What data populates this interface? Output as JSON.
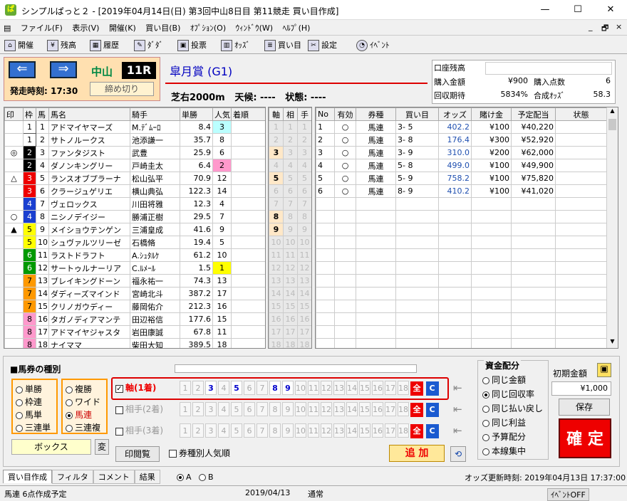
{
  "window": {
    "title": "シンプルぱっと２ - [2019年04月14日(日)  第3回中山8日目  第11競走 買い目作成]",
    "min": "—",
    "max": "☐",
    "close": "✕"
  },
  "menu": [
    "ファイル(F)",
    "表示(V)",
    "開催(K)",
    "買い目(B)",
    "ｵﾌﾟｼｮﾝ(O)",
    "ｳｨﾝﾄﾞｳ(W)",
    "ﾍﾙﾌﾟ(H)"
  ],
  "mdi": {
    "min": "_",
    "restore": "🗗",
    "close": "×"
  },
  "toolbar": [
    "開催",
    "残高",
    "履歴",
    "ﾀﾞﾀﾞ",
    "投票",
    "ｵｯｽﾞ",
    "買い目",
    "設定",
    "ｲﾍﾞﾝﾄ"
  ],
  "race": {
    "venue": "中山",
    "number": "11R",
    "post_time": "発走時刻: 17:30",
    "close_label": "締め切り",
    "name": "皐月賞 (G1)",
    "course": "芝右2000m",
    "weather": "天候: ----",
    "condition": "状態: ----"
  },
  "summary": {
    "account_label": "口座残高",
    "account_value": "",
    "buy_amount_label": "購入金額",
    "buy_amount": "¥900",
    "buy_count_label": "購入点数",
    "buy_count": "6",
    "expected_label": "回収期待",
    "expected": "5834%",
    "odds_label": "合成ｵｯｽﾞ",
    "odds": "58.3"
  },
  "horses_header": [
    "印",
    "枠",
    "馬",
    "馬名",
    "騎手",
    "単勝",
    "人気",
    "着順"
  ],
  "horses": [
    {
      "mark": "",
      "waku": "1",
      "num": "1",
      "name": "アドマイヤマーズ",
      "jockey": "M.ﾃﾞﾑｰﾛ",
      "odds": "8.4",
      "pop": "3",
      "color": "w1",
      "pc": "pop3"
    },
    {
      "mark": "",
      "waku": "1",
      "num": "2",
      "name": "サトノルークス",
      "jockey": "池添謙一",
      "odds": "35.7",
      "pop": "8",
      "color": "w1",
      "pc": ""
    },
    {
      "mark": "◎",
      "waku": "2",
      "num": "3",
      "name": "ファンタジスト",
      "jockey": "武豊",
      "odds": "25.9",
      "pop": "6",
      "color": "w2",
      "pc": ""
    },
    {
      "mark": "",
      "waku": "2",
      "num": "4",
      "name": "ダノンキングリー",
      "jockey": "戸崎圭太",
      "odds": "6.4",
      "pop": "2",
      "color": "w2",
      "pc": "pop2"
    },
    {
      "mark": "△",
      "waku": "3",
      "num": "5",
      "name": "ランスオブプラーナ",
      "jockey": "松山弘平",
      "odds": "70.9",
      "pop": "12",
      "color": "w3",
      "pc": ""
    },
    {
      "mark": "",
      "waku": "3",
      "num": "6",
      "name": "クラージュゲリエ",
      "jockey": "横山典弘",
      "odds": "122.3",
      "pop": "14",
      "color": "w3",
      "pc": ""
    },
    {
      "mark": "",
      "waku": "4",
      "num": "7",
      "name": "ヴェロックス",
      "jockey": "川田将雅",
      "odds": "12.3",
      "pop": "4",
      "color": "w4",
      "pc": ""
    },
    {
      "mark": "○",
      "waku": "4",
      "num": "8",
      "name": "ニシノデイジー",
      "jockey": "勝浦正樹",
      "odds": "29.5",
      "pop": "7",
      "color": "w4",
      "pc": ""
    },
    {
      "mark": "▲",
      "waku": "5",
      "num": "9",
      "name": "メイショウテンゲン",
      "jockey": "三浦皇成",
      "odds": "41.6",
      "pop": "9",
      "color": "w5",
      "pc": ""
    },
    {
      "mark": "",
      "waku": "5",
      "num": "10",
      "name": "シュヴァルツリーゼ",
      "jockey": "石橋脩",
      "odds": "19.4",
      "pop": "5",
      "color": "w5",
      "pc": ""
    },
    {
      "mark": "",
      "waku": "6",
      "num": "11",
      "name": "ラストドラフト",
      "jockey": "A.ｼｭﾀﾙｹ",
      "odds": "61.2",
      "pop": "10",
      "color": "w6",
      "pc": ""
    },
    {
      "mark": "",
      "waku": "6",
      "num": "12",
      "name": "サートゥルナーリア",
      "jockey": "C.ﾙﾒｰﾙ",
      "odds": "1.5",
      "pop": "1",
      "color": "w6",
      "pc": "pop1"
    },
    {
      "mark": "",
      "waku": "7",
      "num": "13",
      "name": "ブレイキングドーン",
      "jockey": "福永祐一",
      "odds": "74.3",
      "pop": "13",
      "color": "w7",
      "pc": ""
    },
    {
      "mark": "",
      "waku": "7",
      "num": "14",
      "name": "ダディーズマインド",
      "jockey": "宮崎北斗",
      "odds": "387.2",
      "pop": "17",
      "color": "w7",
      "pc": ""
    },
    {
      "mark": "",
      "waku": "7",
      "num": "15",
      "name": "クリノガウディー",
      "jockey": "藤岡佑介",
      "odds": "212.3",
      "pop": "16",
      "color": "w7",
      "pc": ""
    },
    {
      "mark": "",
      "waku": "8",
      "num": "16",
      "name": "タガノディアマンテ",
      "jockey": "田辺裕信",
      "odds": "177.6",
      "pop": "15",
      "color": "w8",
      "pc": ""
    },
    {
      "mark": "",
      "waku": "8",
      "num": "17",
      "name": "アドマイヤジャスタ",
      "jockey": "岩田康誠",
      "odds": "67.8",
      "pop": "11",
      "color": "w8",
      "pc": ""
    },
    {
      "mark": "",
      "waku": "8",
      "num": "18",
      "name": "ナイママ",
      "jockey": "柴田大知",
      "odds": "389.5",
      "pop": "18",
      "color": "w8",
      "pc": ""
    }
  ],
  "axis_header": [
    "軸",
    "相",
    "手"
  ],
  "axis_hits": [
    3,
    5,
    8,
    9
  ],
  "bets_header": [
    "No",
    "有効",
    "券種",
    "買い目",
    "オッズ",
    "賭け金",
    "予定配当",
    "状態"
  ],
  "bets": [
    {
      "no": "1",
      "valid": "○",
      "kind": "馬連",
      "combo": "3- 5",
      "odds": "402.2",
      "stake": "¥100",
      "payout": "¥40,220",
      "state": ""
    },
    {
      "no": "2",
      "valid": "○",
      "kind": "馬連",
      "combo": "3- 8",
      "odds": "176.4",
      "stake": "¥300",
      "payout": "¥52,920",
      "state": ""
    },
    {
      "no": "3",
      "valid": "○",
      "kind": "馬連",
      "combo": "3- 9",
      "odds": "310.0",
      "stake": "¥200",
      "payout": "¥62,000",
      "state": ""
    },
    {
      "no": "4",
      "valid": "○",
      "kind": "馬連",
      "combo": "5- 8",
      "odds": "499.0",
      "stake": "¥100",
      "payout": "¥49,900",
      "state": ""
    },
    {
      "no": "5",
      "valid": "○",
      "kind": "馬連",
      "combo": "5- 9",
      "odds": "758.2",
      "stake": "¥100",
      "payout": "¥75,820",
      "state": ""
    },
    {
      "no": "6",
      "valid": "○",
      "kind": "馬連",
      "combo": "8- 9",
      "odds": "410.2",
      "stake": "¥100",
      "payout": "¥41,020",
      "state": ""
    }
  ],
  "kind": {
    "title": "■馬券の種別",
    "left": [
      "単勝",
      "枠連",
      "馬単",
      "三連単"
    ],
    "right": [
      "複勝",
      "ワイド",
      "馬連",
      "三連複"
    ],
    "selected": "馬連",
    "box_label": "ボックス",
    "hen": "変"
  },
  "rows": {
    "axis_label": "軸(1着)",
    "r2_label": "相手(2着)",
    "r3_label": "相手(3着)",
    "all": "全",
    "clear": "C",
    "selected": [
      3,
      5,
      8,
      9
    ]
  },
  "buttons": {
    "print": "印閲覧",
    "per_kind": "券種別人気順",
    "add": "追 加",
    "reset": "⟲"
  },
  "fund": {
    "title": "資金配分",
    "options": [
      "同じ金額",
      "同じ回収率",
      "同じ払い戻し",
      "同じ利益",
      "予算配分",
      "本線集中"
    ],
    "selected": "同じ回収率",
    "initial_label": "初期金額",
    "initial": "¥1,000",
    "save": "保存",
    "confirm": "確 定"
  },
  "tabs": [
    "買い目作成",
    "フィルタ",
    "コメント",
    "結果"
  ],
  "ab": {
    "a": "A",
    "b": "B"
  },
  "odds_update": "オッズ更新時刻: 2019年04月13日  17:37:00",
  "status": {
    "left": "馬連 6点作成予定",
    "date": "2019/04/13",
    "mode": "通常",
    "event": "ｲﾍﾞﾝﾄOFF"
  }
}
